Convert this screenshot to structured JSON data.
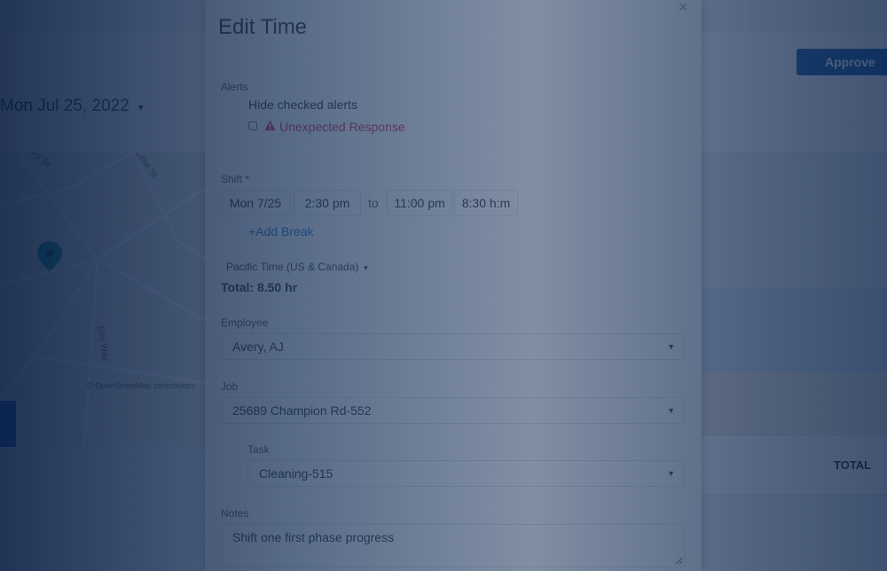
{
  "background": {
    "approve_label": "Approve",
    "date_label": "Mon Jul 25, 2022",
    "date_caret": "▾",
    "map_streets": [
      "Fir St",
      "Lime St",
      "Elm Way"
    ],
    "map_attribution": "© OpenStreetMap contributors",
    "total_label": "TOTAL"
  },
  "modal": {
    "title": "Edit Time",
    "close": "×",
    "alerts": {
      "label": "Alerts",
      "hide_checked": "Hide checked alerts",
      "item": "Unexpected Response",
      "item_color": "#d9304a"
    },
    "shift": {
      "label": "Shift *",
      "date": "Mon 7/25",
      "start": "2:30 pm",
      "to": "to",
      "end": "11:00 pm",
      "duration": "8:30 h:m",
      "add_break": "+Add Break"
    },
    "timezone": "Pacific Time (US & Canada)",
    "total": "Total: 8.50 hr",
    "employee": {
      "label": "Employee",
      "value": "Avery, AJ"
    },
    "job": {
      "label": "Job",
      "value": "25689 Champion Rd-552"
    },
    "task": {
      "label": "Task",
      "value": "Cleaning-515"
    },
    "notes": {
      "label": "Notes",
      "value": "Shift one first phase progress"
    }
  },
  "colors": {
    "accent": "#2a7bd4",
    "approve": "#1f5fa8",
    "overlay": "#0c2a52"
  }
}
